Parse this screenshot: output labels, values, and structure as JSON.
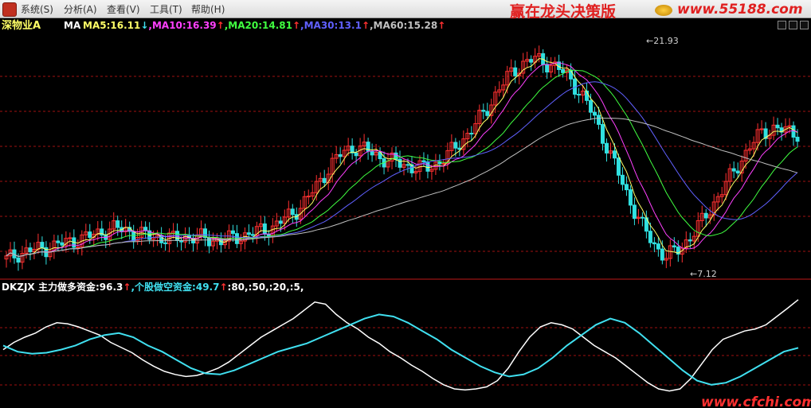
{
  "menubar": {
    "items": [
      "系统(S)",
      "分析(A)",
      "查看(V)",
      "工具(T)",
      "帮助(H)"
    ],
    "brand": "赢在龙头决策版",
    "site": "www.55188.com"
  },
  "main_panel": {
    "stock_name": "深物业A",
    "indicator": "MA",
    "ma_labels": [
      {
        "text": "MA5:16.11",
        "arrow": "↓",
        "color": "#ffff66"
      },
      {
        "text": "MA10:16.39",
        "arrow": "↑",
        "color": "#ff40ff"
      },
      {
        "text": "MA20:14.81",
        "arrow": "↑",
        "color": "#40ff40"
      },
      {
        "text": "MA30:13.1",
        "arrow": "↑",
        "color": "#6060ff"
      },
      {
        "text": "MA60:15.28",
        "arrow": "↑",
        "color": "#c0c0c0"
      }
    ],
    "high_label": "21.93",
    "low_label": "7.12"
  },
  "sub_panel": {
    "indicator": "DKZJX",
    "items": [
      {
        "text": "主力做多资金:96.3",
        "arrow": "↑",
        "color": "#ffffff"
      },
      {
        "text": "个股做空资金:49.7",
        "arrow": "↑",
        "color": "#40e0f0"
      }
    ],
    "suffix": ":80,:50,:20,:5,"
  },
  "watermark": "www.cfchi.com",
  "colors": {
    "up": "#ff3030",
    "down": "#30e0e0",
    "grid": "#a01010",
    "ma5": "#ffff66",
    "ma10": "#ff40ff",
    "ma20": "#40ff40",
    "ma30": "#6060ff",
    "ma60": "#c0c0c0"
  },
  "chart_data": {
    "type": "line",
    "y_range_main": [
      7.12,
      21.93
    ],
    "high": 21.93,
    "low": 7.12,
    "close_path": [
      8.0,
      8.4,
      8.6,
      8.7,
      8.9,
      9.1,
      9.3,
      9.5,
      9.8,
      10.0,
      9.9,
      9.6,
      9.5,
      9.4,
      9.3,
      9.5,
      9.4,
      9.3,
      9.2,
      9.4,
      9.6,
      9.8,
      10.0,
      10.5,
      11.0,
      11.8,
      12.8,
      14.0,
      14.8,
      15.2,
      15.0,
      14.6,
      14.3,
      14.1,
      13.9,
      13.8,
      14.2,
      14.8,
      15.6,
      16.5,
      17.5,
      18.8,
      19.8,
      20.5,
      20.8,
      20.6,
      20.2,
      19.6,
      18.5,
      17.2,
      15.4,
      13.6,
      11.8,
      10.2,
      9.0,
      8.2,
      8.6,
      9.4,
      10.4,
      11.6,
      12.8,
      14.0,
      15.2,
      16.1,
      16.4,
      16.2,
      16.1
    ],
    "ma_series": [
      {
        "name": "MA5",
        "last": 16.11
      },
      {
        "name": "MA10",
        "last": 16.39
      },
      {
        "name": "MA20",
        "last": 14.81
      },
      {
        "name": "MA30",
        "last": 13.1
      },
      {
        "name": "MA60",
        "last": 15.28
      }
    ],
    "sub_series": [
      {
        "name": "主力做多资金",
        "values": [
          48,
          55,
          60,
          64,
          70,
          74,
          73,
          70,
          66,
          62,
          55,
          50,
          45,
          38,
          32,
          27,
          24,
          22,
          23,
          26,
          30,
          36,
          44,
          52,
          60,
          66,
          72,
          78,
          86,
          94,
          92,
          82,
          74,
          68,
          60,
          54,
          46,
          40,
          33,
          27,
          20,
          14,
          10,
          9,
          10,
          12,
          18,
          30,
          46,
          60,
          70,
          74,
          72,
          68,
          60,
          52,
          46,
          40,
          32,
          24,
          16,
          10,
          8,
          10,
          20,
          34,
          48,
          58,
          62,
          66,
          68,
          72,
          80,
          88,
          96.3
        ]
      },
      {
        "name": "个股做空资金",
        "values": [
          52,
          46,
          44,
          45,
          48,
          52,
          58,
          62,
          64,
          60,
          52,
          46,
          38,
          30,
          25,
          24,
          28,
          34,
          40,
          46,
          50,
          54,
          60,
          66,
          72,
          78,
          82,
          80,
          74,
          66,
          58,
          48,
          40,
          32,
          26,
          22,
          24,
          30,
          40,
          52,
          62,
          72,
          78,
          74,
          64,
          52,
          40,
          28,
          18,
          14,
          16,
          22,
          30,
          38,
          46,
          49.7
        ]
      }
    ]
  }
}
